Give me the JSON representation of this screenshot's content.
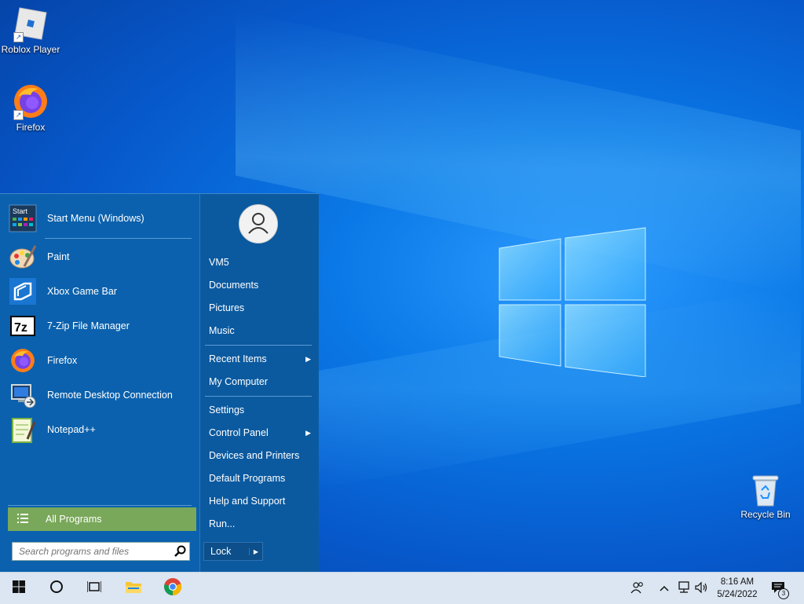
{
  "desktop": {
    "icons": [
      {
        "label": "Roblox Player",
        "icon": "roblox-icon"
      },
      {
        "label": "Firefox",
        "icon": "firefox-icon"
      },
      {
        "label": "Recycle Bin",
        "icon": "recycle-bin-icon"
      }
    ]
  },
  "start_menu": {
    "pinned": {
      "label": "Start Menu (Windows)",
      "icon": "start-menu-icon",
      "icon_text": "Start"
    },
    "programs": [
      {
        "label": "Paint",
        "icon": "paint-icon"
      },
      {
        "label": "Xbox Game Bar",
        "icon": "xbox-game-bar-icon"
      },
      {
        "label": "7-Zip File Manager",
        "icon": "7zip-icon",
        "icon_text": "7z"
      },
      {
        "label": "Firefox",
        "icon": "firefox-icon"
      },
      {
        "label": "Remote Desktop Connection",
        "icon": "remote-desktop-icon"
      },
      {
        "label": "Notepad++",
        "icon": "notepad-plus-plus-icon"
      }
    ],
    "all_programs": "All Programs",
    "search_placeholder": "Search programs and files",
    "right": {
      "user": "VM5",
      "group1": [
        "Documents",
        "Pictures",
        "Music"
      ],
      "recent_items": "Recent Items",
      "my_computer": "My Computer",
      "settings": "Settings",
      "control_panel": "Control Panel",
      "devices_and_printers": "Devices and Printers",
      "default_programs": "Default Programs",
      "help_and_support": "Help and Support",
      "run": "Run...",
      "lock": "Lock"
    },
    "accent": "#79a85a",
    "background": "#0b61ad"
  },
  "taskbar": {
    "time": "8:16 AM",
    "date": "5/24/2022",
    "notification_count": "3",
    "apps": [
      "start-button",
      "search-cortana",
      "task-view",
      "file-explorer",
      "chrome"
    ]
  }
}
